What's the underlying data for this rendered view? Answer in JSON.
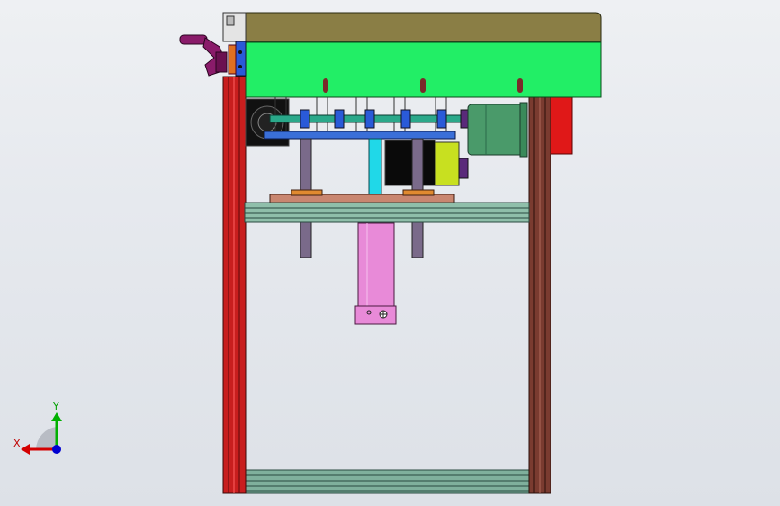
{
  "view": {
    "background": "#e6e9ee"
  },
  "triad": {
    "x_label": "X",
    "y_label": "Y",
    "x_color": "#d40000",
    "y_color": "#00b000",
    "z_color": "#0000d0"
  },
  "colors": {
    "frame_red": "#c81e1e",
    "frame_brown": "#7a3b30",
    "cover_olive": "#8a7e45",
    "housing_green": "#22ee66",
    "plate_blue": "#3a6fd8",
    "motor_green": "#4a9a6a",
    "cylinder_pink": "#e88ad8",
    "copper_plate": "#c98670",
    "rail_teal": "#8fbfaa",
    "handle_purple": "#8a1b6a",
    "bracket_red": "#e01818",
    "cyan_rod": "#20d8e8",
    "gear_yellow": "#c8e020"
  }
}
